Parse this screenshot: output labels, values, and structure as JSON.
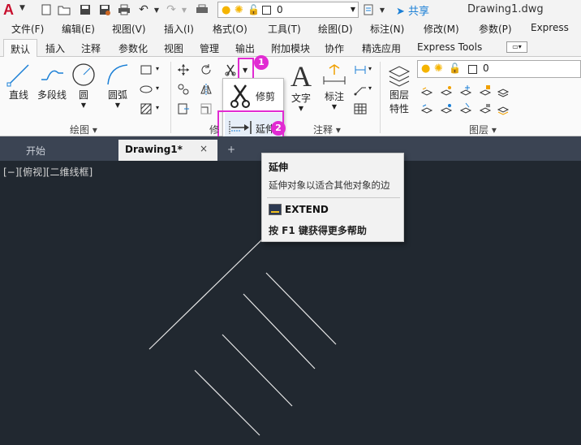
{
  "app": {
    "logo": "A",
    "document_title": "Drawing1.dwg",
    "share_label": "共享"
  },
  "quick_access": {
    "layer_value": "0"
  },
  "menu": [
    "文件(F)",
    "编辑(E)",
    "视图(V)",
    "插入(I)",
    "格式(O)",
    "工具(T)",
    "绘图(D)",
    "标注(N)",
    "修改(M)",
    "参数(P)",
    "Express"
  ],
  "ribbon_tabs": [
    "默认",
    "插入",
    "注释",
    "参数化",
    "视图",
    "管理",
    "输出",
    "附加模块",
    "协作",
    "精选应用",
    "Express Tools"
  ],
  "ribbon": {
    "draw": {
      "line": "直线",
      "polyline": "多段线",
      "circle": "圆",
      "arc": "圆弧",
      "panel": "绘图"
    },
    "modify": {
      "panel": "修"
    },
    "annotation": {
      "text": "文字",
      "dimension": "标注",
      "panel": "注释"
    },
    "layers": {
      "properties_line1": "图层",
      "properties_line2": "特性",
      "current": "0",
      "panel": "图层"
    }
  },
  "trim_dropdown": {
    "trim": "修剪",
    "extend": "延伸"
  },
  "callouts": [
    "1",
    "2"
  ],
  "doc_tabs": {
    "start": "开始",
    "drawing": "Drawing1*",
    "close": "×",
    "add": "+"
  },
  "viewport_label": "[−][俯视][二维线框]",
  "tooltip": {
    "title": "延伸",
    "description": "延伸对象以适合其他对象的边",
    "command": "EXTEND",
    "help": "按 F1 键获得更多帮助"
  },
  "colors": {
    "accent": "#e12bd2",
    "canvas": "#212830",
    "share": "#1a7fd6"
  }
}
